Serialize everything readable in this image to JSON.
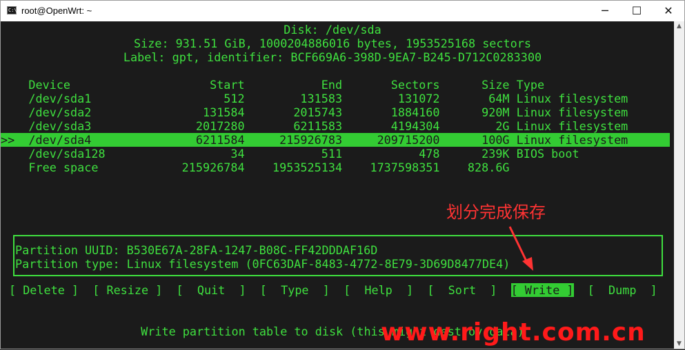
{
  "window": {
    "title": "root@OpenWrt: ~",
    "app_icon_text": "C:\\",
    "minimize_glyph": "─",
    "maximize_glyph": "☐",
    "close_glyph": "✕"
  },
  "disk": {
    "line1": "Disk: /dev/sda",
    "line2": "Size: 931.51 GiB, 1000204886016 bytes, 1953525168 sectors",
    "line3": "Label: gpt, identifier: BCF669A6-398D-9EA7-B245-D712C0283300"
  },
  "table": {
    "columns": [
      "Device",
      "Start",
      "End",
      "Sectors",
      "Size",
      "Type"
    ],
    "header_line": "    Device                    Start           End       Sectors      Size Type",
    "rows": [
      {
        "device": "/dev/sda1",
        "start": "512",
        "end": "131583",
        "sectors": "131072",
        "size": "64M",
        "type": "Linux filesystem",
        "line": "    /dev/sda1                   512        131583        131072       64M Linux filesystem"
      },
      {
        "device": "/dev/sda2",
        "start": "131584",
        "end": "2015743",
        "sectors": "1884160",
        "size": "920M",
        "type": "Linux filesystem",
        "line": "    /dev/sda2                131584       2015743       1884160      920M Linux filesystem"
      },
      {
        "device": "/dev/sda3",
        "start": "2017280",
        "end": "6211583",
        "sectors": "4194304",
        "size": "2G",
        "type": "Linux filesystem",
        "line": "    /dev/sda3               2017280       6211583       4194304        2G Linux filesystem"
      },
      {
        "device": "/dev/sda4",
        "start": "6211584",
        "end": "215926783",
        "sectors": "209715200",
        "size": "100G",
        "type": "Linux filesystem",
        "selected": true,
        "line": ">>  /dev/sda4               6211584     215926783     209715200      100G Linux filesystem"
      },
      {
        "device": "/dev/sda128",
        "start": "34",
        "end": "511",
        "sectors": "478",
        "size": "239K",
        "type": "BIOS boot",
        "line": "    /dev/sda128                  34           511           478      239K BIOS boot"
      },
      {
        "device": "Free space",
        "start": "215926784",
        "end": "1953525134",
        "sectors": "1737598351",
        "size": "828.6G",
        "type": "",
        "line": "    Free space            215926784    1953525134    1737598351    828.6G"
      }
    ]
  },
  "info": {
    "uuid_line": "Partition UUID: B530E67A-28FA-1247-B08C-FF42DDDAF16D",
    "type_line": "Partition type: Linux filesystem (0FC63DAF-8483-4772-8E79-3D69D8477DE4)"
  },
  "menu": {
    "delete": "[ Delete ]",
    "resize": "[ Resize ]",
    "quit": "[  Quit  ]",
    "type": "[  Type  ]",
    "help": "[  Help  ]",
    "sort": "[  Sort  ]",
    "write": "[ Write ]",
    "dump": "[  Dump  ]"
  },
  "status_line": "Write partition table to disk (this might destroy data)",
  "annotation": "划分完成保存",
  "watermark": "www.right.com.cn",
  "colors": {
    "terminal_fg": "#3fe03f",
    "terminal_bg": "#1b1b1b",
    "highlight_bg": "#33cc33",
    "annotation": "#ff3333",
    "watermark": "#ff1a1a"
  }
}
